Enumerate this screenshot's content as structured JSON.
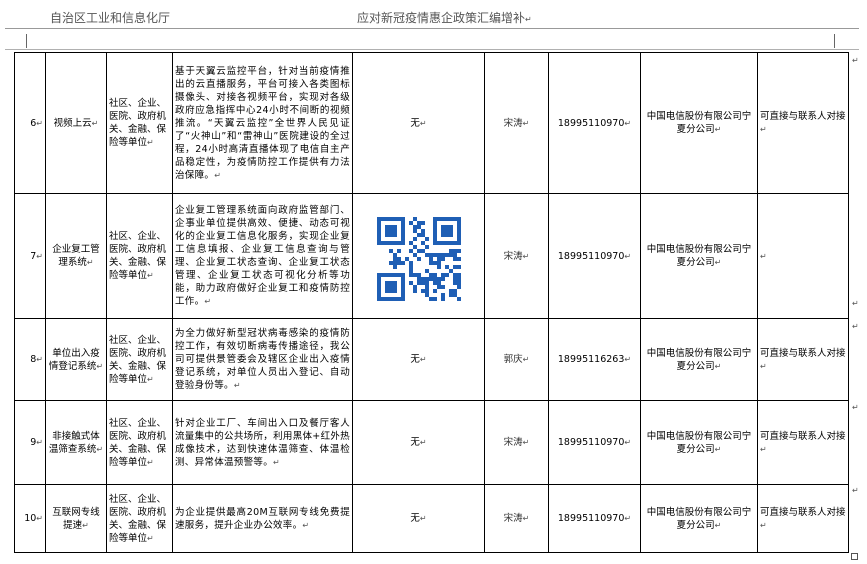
{
  "header": {
    "left_title": "自治区工业和信息化厅",
    "center_title": "应对新冠疫情惠企政策汇编增补"
  },
  "rows": [
    {
      "num": "6",
      "name": "视频上云",
      "targets": "社区、企业、医院、政府机关、金融、保险等单位",
      "description": "基于天翼云监控平台，针对当前疫情推出的云直播服务，平台可接入各类图标摄像头、对接各视频平台，实现对各级政府应急指挥中心24小时不间断的视频推流。“天翼云监控”全世界人民见证了“火神山”和“雷神山”医院建设的全过程，24小时高清直播体现了电信自主产品稳定性，为疫情防控工作提供有力法治保障。",
      "qr": "无",
      "contact": "宋涛",
      "phone": "18995110970",
      "company": "中国电信股份有限公司宁夏分公司",
      "note": "可直接与联系人对接"
    },
    {
      "num": "7",
      "name": "企业复工管理系统",
      "targets": "社区、企业、医院、政府机关、金融、保险等单位",
      "description": "企业复工管理系统面向政府监管部门、企事业单位提供高效、便捷、动态可视化的企业复工信息化服务，实现企业复工信息填报、企业复工信息查询与管理、企业复工状态查询、企业复工状态管理、企业复工状态可视化分析等功能，助力政府做好企业复工和疫情防控工作。",
      "qr": "",
      "contact": "宋涛",
      "phone": "18995110970",
      "company": "中国电信股份有限公司宁夏分公司",
      "note": ""
    },
    {
      "num": "8",
      "name": "单位出入疫情登记系统",
      "targets": "社区、企业、医院、政府机关、金融、保险等单位",
      "description": "为全力做好新型冠状病毒感染的疫情防控工作，有效切断病毒传播途径，我公司可提供景管委会及辖区企业出入疫情登记系统，对单位人员出入登记、自动登验身份等。",
      "qr": "无",
      "contact": "郭庆",
      "phone": "18995116263",
      "company": "中国电信股份有限公司宁夏分公司",
      "note": "可直接与联系人对接"
    },
    {
      "num": "9",
      "name": "非接触式体温筛查系统",
      "targets": "社区、企业、医院、政府机关、金融、保险等单位",
      "description": "针对企业工厂、车间出入口及餐厅客人流量集中的公共场所，利用黑体+红外热成像技术，达到快速体温筛查、体温检测、异常体温预警等。",
      "qr": "无",
      "contact": "宋涛",
      "phone": "18995110970",
      "company": "中国电信股份有限公司宁夏分公司",
      "note": "可直接与联系人对接"
    },
    {
      "num": "10",
      "name": "互联网专线提速",
      "targets": "社区、企业、医院、政府机关、金融、保险等单位",
      "description": "为企业提供最高20M互联网专线免费提速服务，提升企业办公效率。",
      "qr": "无",
      "contact": "宋涛",
      "phone": "18995110970",
      "company": "中国电信股份有限公司宁夏分公司",
      "note": "可直接与联系人对接"
    }
  ],
  "paragraph_mark": "↵",
  "qr_color": "#1f5fb5"
}
